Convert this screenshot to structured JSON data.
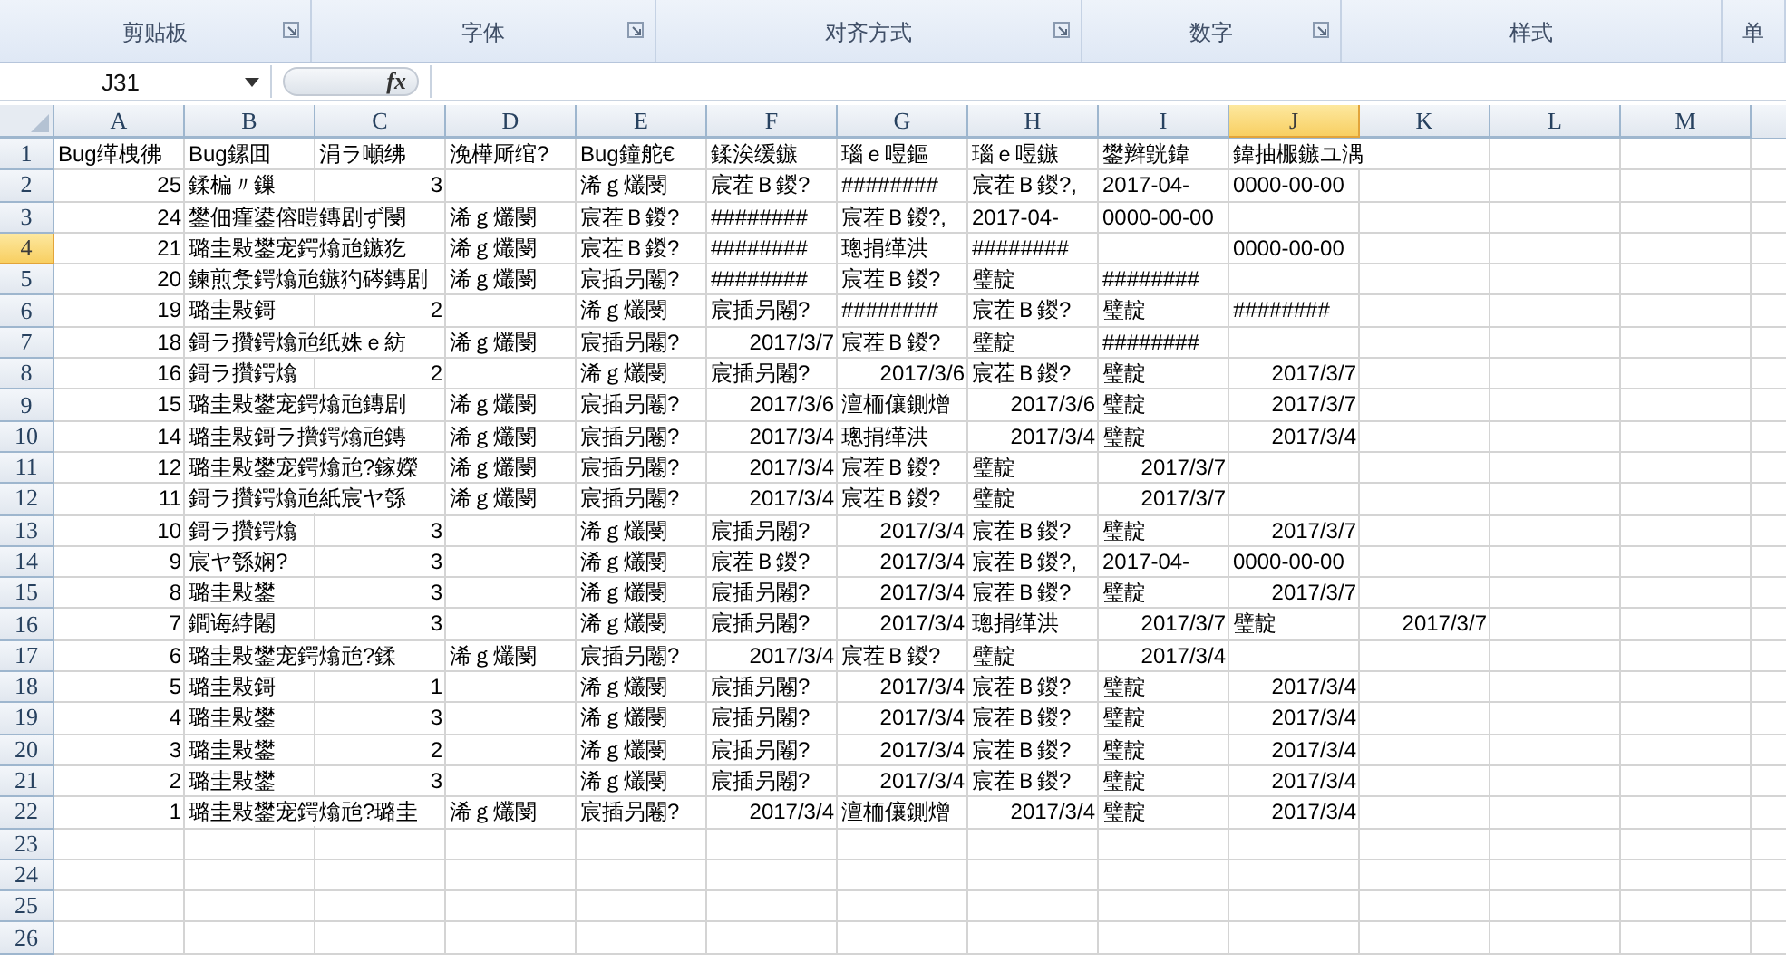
{
  "ribbon": {
    "groups": [
      {
        "label": "剪贴板",
        "launcher": true
      },
      {
        "label": "字体",
        "launcher": true
      },
      {
        "label": "对齐方式",
        "launcher": true
      },
      {
        "label": "数字",
        "launcher": true
      },
      {
        "label": "样式",
        "launcher": false
      },
      {
        "label": "单",
        "launcher": false
      }
    ]
  },
  "formula_bar": {
    "name_box": "J31",
    "function_button": "fx"
  },
  "sheet": {
    "columns": [
      {
        "label": "A",
        "selected": false
      },
      {
        "label": "B",
        "selected": false
      },
      {
        "label": "C",
        "selected": false
      },
      {
        "label": "D",
        "selected": false
      },
      {
        "label": "E",
        "selected": false
      },
      {
        "label": "F",
        "selected": false
      },
      {
        "label": "G",
        "selected": false
      },
      {
        "label": "H",
        "selected": false
      },
      {
        "label": "I",
        "selected": false
      },
      {
        "label": "J",
        "selected": true
      },
      {
        "label": "K",
        "selected": false
      },
      {
        "label": "L",
        "selected": false
      },
      {
        "label": "M",
        "selected": false
      }
    ],
    "rows": [
      {
        "number": "1",
        "selected": false,
        "cells": {
          "A": {
            "text": "Bug缂栧彿",
            "kind": "text"
          },
          "B": {
            "text": "Bug鏍囬",
            "kind": "text"
          },
          "C": {
            "text": "涓ラ噸绋",
            "kind": "text"
          },
          "D": {
            "text": "浼樺厛绾?",
            "kind": "text"
          },
          "E": {
            "text": "Bug鐘舵€",
            "kind": "text"
          },
          "F": {
            "text": "鍒涘缓鏃",
            "kind": "text"
          },
          "G": {
            "text": "瑙ｅ喅鏂",
            "kind": "text"
          },
          "H": {
            "text": "瑙ｅ喅鏃",
            "kind": "text"
          },
          "I": {
            "text": "鐢辫皝鍏",
            "kind": "text"
          },
          "J": {
            "text": "鍏抽棴鏃ユ湡",
            "kind": "text"
          }
        }
      },
      {
        "number": "2",
        "selected": false,
        "cells": {
          "A": {
            "text": "25",
            "kind": "number"
          },
          "B": {
            "text": "鍒楄〃鏁",
            "kind": "text"
          },
          "C": {
            "text": "3",
            "kind": "number"
          },
          "E": {
            "text": "浠ｇ爜閿",
            "kind": "text"
          },
          "F": {
            "text": "宸茬Ｂ鍐?",
            "kind": "text"
          },
          "G": {
            "text": "########",
            "kind": "text"
          },
          "H": {
            "text": "宸茬Ｂ鍐?,",
            "kind": "text"
          },
          "I": {
            "text": "2017-04-",
            "kind": "text"
          },
          "J": {
            "text": "0000-00-00",
            "kind": "text"
          }
        }
      },
      {
        "number": "3",
        "selected": false,
        "cells": {
          "A": {
            "text": "24",
            "kind": "number"
          },
          "B": {
            "text": "鐢佃瘽鍙傛暟鏄剧ず閿",
            "kind": "text"
          },
          "D": {
            "text": "浠ｇ爜閿",
            "kind": "text"
          },
          "E": {
            "text": "宸茬Ｂ鍐?",
            "kind": "text"
          },
          "F": {
            "text": "########",
            "kind": "text"
          },
          "G": {
            "text": "宸茬Ｂ鍐?,",
            "kind": "text"
          },
          "H": {
            "text": "2017-04-",
            "kind": "text"
          },
          "I": {
            "text": "0000-00-00",
            "kind": "text"
          }
        }
      },
      {
        "number": "4",
        "selected": true,
        "cells": {
          "A": {
            "text": "21",
            "kind": "number"
          },
          "B": {
            "text": "璐圭敤鐢宠鍔熻兘鏃犵",
            "kind": "text"
          },
          "D": {
            "text": "浠ｇ爜閿",
            "kind": "text"
          },
          "E": {
            "text": "宸茬Ｂ鍐?",
            "kind": "text"
          },
          "F": {
            "text": "########",
            "kind": "text"
          },
          "G": {
            "text": "璁捐缂洪",
            "kind": "text"
          },
          "H": {
            "text": "########",
            "kind": "text"
          },
          "J": {
            "text": "0000-00-00",
            "kind": "text"
          }
        }
      },
      {
        "number": "5",
        "selected": false,
        "cells": {
          "A": {
            "text": "20",
            "kind": "number"
          },
          "B": {
            "text": "鍊煎洜鍔熻兘鏃犳硶鏄剧",
            "kind": "text"
          },
          "D": {
            "text": "浠ｇ爜閿",
            "kind": "text"
          },
          "E": {
            "text": "宸插叧闂?",
            "kind": "text"
          },
          "F": {
            "text": "########",
            "kind": "text"
          },
          "G": {
            "text": "宸茬Ｂ鍐?",
            "kind": "text"
          },
          "H": {
            "text": "璧靛",
            "kind": "text"
          },
          "I": {
            "text": "########",
            "kind": "text"
          }
        }
      },
      {
        "number": "6",
        "selected": false,
        "cells": {
          "A": {
            "text": "19",
            "kind": "number"
          },
          "B": {
            "text": "璐圭敤鎶",
            "kind": "text"
          },
          "C": {
            "text": "2",
            "kind": "number"
          },
          "E": {
            "text": "浠ｇ爜閿",
            "kind": "text"
          },
          "F": {
            "text": "宸插叧闂?",
            "kind": "text"
          },
          "G": {
            "text": "########",
            "kind": "text"
          },
          "H": {
            "text": "宸茬Ｂ鍐?",
            "kind": "text"
          },
          "I": {
            "text": "璧靛",
            "kind": "text"
          },
          "J": {
            "text": "########",
            "kind": "text"
          }
        }
      },
      {
        "number": "7",
        "selected": false,
        "cells": {
          "A": {
            "text": "18",
            "kind": "number"
          },
          "B": {
            "text": "鎶ラ攢鍔熻兘纸姝ｅ紡",
            "kind": "text"
          },
          "D": {
            "text": "浠ｇ爜閿",
            "kind": "text"
          },
          "E": {
            "text": "宸插叧闂?",
            "kind": "text"
          },
          "F": {
            "text": "2017/3/7",
            "kind": "number"
          },
          "G": {
            "text": "宸茬Ｂ鍐?",
            "kind": "text"
          },
          "H": {
            "text": "璧靛",
            "kind": "text"
          },
          "I": {
            "text": "########",
            "kind": "text"
          }
        }
      },
      {
        "number": "8",
        "selected": false,
        "cells": {
          "A": {
            "text": "16",
            "kind": "number"
          },
          "B": {
            "text": "鎶ラ攢鍔熻",
            "kind": "text"
          },
          "C": {
            "text": "2",
            "kind": "number"
          },
          "E": {
            "text": "浠ｇ爜閿",
            "kind": "text"
          },
          "F": {
            "text": "宸插叧闂?",
            "kind": "text"
          },
          "G": {
            "text": "2017/3/6",
            "kind": "number"
          },
          "H": {
            "text": "宸茬Ｂ鍐?",
            "kind": "text"
          },
          "I": {
            "text": "璧靛",
            "kind": "text"
          },
          "J": {
            "text": "2017/3/7",
            "kind": "number"
          }
        }
      },
      {
        "number": "9",
        "selected": false,
        "cells": {
          "A": {
            "text": "15",
            "kind": "number"
          },
          "B": {
            "text": "璐圭敤鐢宠鍔熻兘鏄剧",
            "kind": "text"
          },
          "D": {
            "text": "浠ｇ爜閿",
            "kind": "text"
          },
          "E": {
            "text": "宸插叧闂?",
            "kind": "text"
          },
          "F": {
            "text": "2017/3/6",
            "kind": "number"
          },
          "G": {
            "text": "澶栭儴鍘熷",
            "kind": "text"
          },
          "H": {
            "text": "2017/3/6",
            "kind": "number"
          },
          "I": {
            "text": "璧靛",
            "kind": "text"
          },
          "J": {
            "text": "2017/3/7",
            "kind": "number"
          }
        }
      },
      {
        "number": "10",
        "selected": false,
        "cells": {
          "A": {
            "text": "14",
            "kind": "number"
          },
          "B": {
            "text": "璐圭敤鎶ラ攢鍔熻兘鏄",
            "kind": "text"
          },
          "D": {
            "text": "浠ｇ爜閿",
            "kind": "text"
          },
          "E": {
            "text": "宸插叧闂?",
            "kind": "text"
          },
          "F": {
            "text": "2017/3/4",
            "kind": "number"
          },
          "G": {
            "text": "璁捐缂洪",
            "kind": "text"
          },
          "H": {
            "text": "2017/3/4",
            "kind": "number"
          },
          "I": {
            "text": "璧靛",
            "kind": "text"
          },
          "J": {
            "text": "2017/3/4",
            "kind": "number"
          }
        }
      },
      {
        "number": "11",
        "selected": false,
        "cells": {
          "A": {
            "text": "12",
            "kind": "number"
          },
          "B": {
            "text": "璐圭敤鐢宠鍔熻兘?鎵嬫",
            "kind": "text"
          },
          "D": {
            "text": "浠ｇ爜閿",
            "kind": "text"
          },
          "E": {
            "text": "宸插叧闂?",
            "kind": "text"
          },
          "F": {
            "text": "2017/3/4",
            "kind": "number"
          },
          "G": {
            "text": "宸茬Ｂ鍐?",
            "kind": "text"
          },
          "H": {
            "text": "璧靛",
            "kind": "text"
          },
          "I": {
            "text": "2017/3/7",
            "kind": "number"
          }
        }
      },
      {
        "number": "12",
        "selected": false,
        "cells": {
          "A": {
            "text": "11",
            "kind": "number"
          },
          "B": {
            "text": "鎶ラ攢鍔熻兘紙宸ヤ綔",
            "kind": "text"
          },
          "D": {
            "text": "浠ｇ爜閿",
            "kind": "text"
          },
          "E": {
            "text": "宸插叧闂?",
            "kind": "text"
          },
          "F": {
            "text": "2017/3/4",
            "kind": "number"
          },
          "G": {
            "text": "宸茬Ｂ鍐?",
            "kind": "text"
          },
          "H": {
            "text": "璧靛",
            "kind": "text"
          },
          "I": {
            "text": "2017/3/7",
            "kind": "number"
          }
        }
      },
      {
        "number": "13",
        "selected": false,
        "cells": {
          "A": {
            "text": "10",
            "kind": "number"
          },
          "B": {
            "text": "鎶ラ攢鍔熻",
            "kind": "text"
          },
          "C": {
            "text": "3",
            "kind": "number"
          },
          "E": {
            "text": "浠ｇ爜閿",
            "kind": "text"
          },
          "F": {
            "text": "宸插叧闂?",
            "kind": "text"
          },
          "G": {
            "text": "2017/3/4",
            "kind": "number"
          },
          "H": {
            "text": "宸茬Ｂ鍐?",
            "kind": "text"
          },
          "I": {
            "text": "璧靛",
            "kind": "text"
          },
          "J": {
            "text": "2017/3/7",
            "kind": "number"
          }
        }
      },
      {
        "number": "14",
        "selected": false,
        "cells": {
          "A": {
            "text": "9",
            "kind": "number"
          },
          "B": {
            "text": "宸ヤ綔娴?",
            "kind": "text"
          },
          "C": {
            "text": "3",
            "kind": "number"
          },
          "E": {
            "text": "浠ｇ爜閿",
            "kind": "text"
          },
          "F": {
            "text": "宸茬Ｂ鍐?",
            "kind": "text"
          },
          "G": {
            "text": "2017/3/4",
            "kind": "number"
          },
          "H": {
            "text": "宸茬Ｂ鍐?,",
            "kind": "text"
          },
          "I": {
            "text": "2017-04-",
            "kind": "text"
          },
          "J": {
            "text": "0000-00-00",
            "kind": "text"
          }
        }
      },
      {
        "number": "15",
        "selected": false,
        "cells": {
          "A": {
            "text": "8",
            "kind": "number"
          },
          "B": {
            "text": "璐圭敤鐢",
            "kind": "text"
          },
          "C": {
            "text": "3",
            "kind": "number"
          },
          "E": {
            "text": "浠ｇ爜閿",
            "kind": "text"
          },
          "F": {
            "text": "宸插叧闂?",
            "kind": "text"
          },
          "G": {
            "text": "2017/3/4",
            "kind": "number"
          },
          "H": {
            "text": "宸茬Ｂ鍐?",
            "kind": "text"
          },
          "I": {
            "text": "璧靛",
            "kind": "text"
          },
          "J": {
            "text": "2017/3/7",
            "kind": "number"
          }
        }
      },
      {
        "number": "16",
        "selected": false,
        "cells": {
          "A": {
            "text": "7",
            "kind": "number"
          },
          "B": {
            "text": "鐧诲綍闂",
            "kind": "text"
          },
          "C": {
            "text": "3",
            "kind": "number"
          },
          "E": {
            "text": "浠ｇ爜閿",
            "kind": "text"
          },
          "F": {
            "text": "宸插叧闂?",
            "kind": "text"
          },
          "G": {
            "text": "2017/3/4",
            "kind": "number"
          },
          "H": {
            "text": "璁捐缂洪",
            "kind": "text"
          },
          "I": {
            "text": "2017/3/7",
            "kind": "number"
          },
          "J": {
            "text": "璧靛",
            "kind": "text"
          },
          "K": {
            "text": "2017/3/7",
            "kind": "number"
          }
        }
      },
      {
        "number": "17",
        "selected": false,
        "cells": {
          "A": {
            "text": "6",
            "kind": "number"
          },
          "B": {
            "text": "璐圭敤鐢宠鍔熻兘?鍒",
            "kind": "text"
          },
          "D": {
            "text": "浠ｇ爜閿",
            "kind": "text"
          },
          "E": {
            "text": "宸插叧闂?",
            "kind": "text"
          },
          "F": {
            "text": "2017/3/4",
            "kind": "number"
          },
          "G": {
            "text": "宸茬Ｂ鍐?",
            "kind": "text"
          },
          "H": {
            "text": "璧靛",
            "kind": "text"
          },
          "I": {
            "text": "2017/3/4",
            "kind": "number"
          }
        }
      },
      {
        "number": "18",
        "selected": false,
        "cells": {
          "A": {
            "text": "5",
            "kind": "number"
          },
          "B": {
            "text": "璐圭敤鎶",
            "kind": "text"
          },
          "C": {
            "text": "1",
            "kind": "number"
          },
          "E": {
            "text": "浠ｇ爜閿",
            "kind": "text"
          },
          "F": {
            "text": "宸插叧闂?",
            "kind": "text"
          },
          "G": {
            "text": "2017/3/4",
            "kind": "number"
          },
          "H": {
            "text": "宸茬Ｂ鍐?",
            "kind": "text"
          },
          "I": {
            "text": "璧靛",
            "kind": "text"
          },
          "J": {
            "text": "2017/3/4",
            "kind": "number"
          }
        }
      },
      {
        "number": "19",
        "selected": false,
        "cells": {
          "A": {
            "text": "4",
            "kind": "number"
          },
          "B": {
            "text": "璐圭敤鐢",
            "kind": "text"
          },
          "C": {
            "text": "3",
            "kind": "number"
          },
          "E": {
            "text": "浠ｇ爜閿",
            "kind": "text"
          },
          "F": {
            "text": "宸插叧闂?",
            "kind": "text"
          },
          "G": {
            "text": "2017/3/4",
            "kind": "number"
          },
          "H": {
            "text": "宸茬Ｂ鍐?",
            "kind": "text"
          },
          "I": {
            "text": "璧靛",
            "kind": "text"
          },
          "J": {
            "text": "2017/3/4",
            "kind": "number"
          }
        }
      },
      {
        "number": "20",
        "selected": false,
        "cells": {
          "A": {
            "text": "3",
            "kind": "number"
          },
          "B": {
            "text": "璐圭敤鐢",
            "kind": "text"
          },
          "C": {
            "text": "2",
            "kind": "number"
          },
          "E": {
            "text": "浠ｇ爜閿",
            "kind": "text"
          },
          "F": {
            "text": "宸插叧闂?",
            "kind": "text"
          },
          "G": {
            "text": "2017/3/4",
            "kind": "number"
          },
          "H": {
            "text": "宸茬Ｂ鍐?",
            "kind": "text"
          },
          "I": {
            "text": "璧靛",
            "kind": "text"
          },
          "J": {
            "text": "2017/3/4",
            "kind": "number"
          }
        }
      },
      {
        "number": "21",
        "selected": false,
        "cells": {
          "A": {
            "text": "2",
            "kind": "number"
          },
          "B": {
            "text": "璐圭敤鐢",
            "kind": "text"
          },
          "C": {
            "text": "3",
            "kind": "number"
          },
          "E": {
            "text": "浠ｇ爜閿",
            "kind": "text"
          },
          "F": {
            "text": "宸插叧闂?",
            "kind": "text"
          },
          "G": {
            "text": "2017/3/4",
            "kind": "number"
          },
          "H": {
            "text": "宸茬Ｂ鍐?",
            "kind": "text"
          },
          "I": {
            "text": "璧靛",
            "kind": "text"
          },
          "J": {
            "text": "2017/3/4",
            "kind": "number"
          }
        }
      },
      {
        "number": "22",
        "selected": false,
        "cells": {
          "A": {
            "text": "1",
            "kind": "number"
          },
          "B": {
            "text": "璐圭敤鐢宠鍔熻兘?璐圭",
            "kind": "text"
          },
          "D": {
            "text": "浠ｇ爜閿",
            "kind": "text"
          },
          "E": {
            "text": "宸插叧闂?",
            "kind": "text"
          },
          "F": {
            "text": "2017/3/4",
            "kind": "number"
          },
          "G": {
            "text": "澶栭儴鍘熷",
            "kind": "text"
          },
          "H": {
            "text": "2017/3/4",
            "kind": "number"
          },
          "I": {
            "text": "璧靛",
            "kind": "text"
          },
          "J": {
            "text": "2017/3/4",
            "kind": "number"
          }
        }
      },
      {
        "number": "23",
        "selected": false
      },
      {
        "number": "24",
        "selected": false
      },
      {
        "number": "25",
        "selected": false
      },
      {
        "number": "26",
        "selected": false
      }
    ]
  }
}
